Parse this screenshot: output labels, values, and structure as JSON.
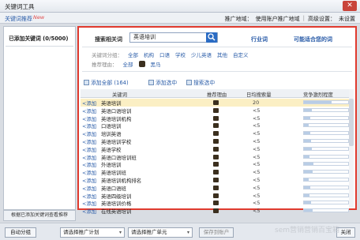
{
  "window": {
    "title": "关键词工具"
  },
  "subbar": {
    "label": "关键词推荐",
    "badge": "New",
    "opt1": "推广地域：",
    "opt2": "使用账户推广地域",
    "opt3": "高级设置：",
    "opt4": "未设置"
  },
  "left_panel": {
    "header": "已添加关键词 (0/5000)",
    "bottom_button": "根据已添加关键词查看推荐"
  },
  "search": {
    "label": "搜索相关词",
    "value": "英语培训",
    "tab_industry": "行业词",
    "tab_conversion": "可能适合您的词"
  },
  "filters": {
    "group_label": "关键词分组：",
    "groups": [
      "全部",
      "机构",
      "口语",
      "学校",
      "少儿英语",
      "其他",
      "自定义"
    ],
    "reason_label": "推荐理由：",
    "reasons": [
      "全部",
      "黑马"
    ]
  },
  "toolbar": {
    "add_all": "添加全部 (164)",
    "add_selected": "添加选中",
    "search_selected": "搜索选中"
  },
  "table": {
    "headers": [
      "关键词",
      "推荐理由",
      "日均搜索量",
      "竞争激烈程度"
    ],
    "add_label": "<添加",
    "rows": [
      {
        "kw": "英语培训",
        "vol": "20",
        "comp": 0.62
      },
      {
        "kw": "英语口语培训",
        "vol": "<5",
        "comp": 0.18
      },
      {
        "kw": "英语培训机构",
        "vol": "<5",
        "comp": 0.15
      },
      {
        "kw": "口语培训",
        "vol": "<5",
        "comp": 0.1
      },
      {
        "kw": "培训英语",
        "vol": "<5",
        "comp": 0.14
      },
      {
        "kw": "英语培训学校",
        "vol": "<5",
        "comp": 0.16
      },
      {
        "kw": "英语学校",
        "vol": "<5",
        "comp": 0.18
      },
      {
        "kw": "英语口语培训班",
        "vol": "<5",
        "comp": 0.12
      },
      {
        "kw": "外语培训",
        "vol": "<5",
        "comp": 0.22
      },
      {
        "kw": "英语培训班",
        "vol": "<5",
        "comp": 0.2
      },
      {
        "kw": "英语培训机构排名",
        "vol": "<5",
        "comp": 0.1
      },
      {
        "kw": "英语口语班",
        "vol": "<5",
        "comp": 0.14
      },
      {
        "kw": "英语四级培训",
        "vol": "<5",
        "comp": 0.12
      },
      {
        "kw": "英语培训价格",
        "vol": "<5",
        "comp": 0.16
      },
      {
        "kw": "在线英语培训",
        "vol": "<5",
        "comp": 0.2
      }
    ]
  },
  "footer": {
    "auto_group": "自动分组",
    "plan_select": "请选择推广计划",
    "unit_select": "请选择推广单元",
    "save": "保存到账户",
    "close": "关闭",
    "watermark": "sem营销营销百宝箱"
  }
}
